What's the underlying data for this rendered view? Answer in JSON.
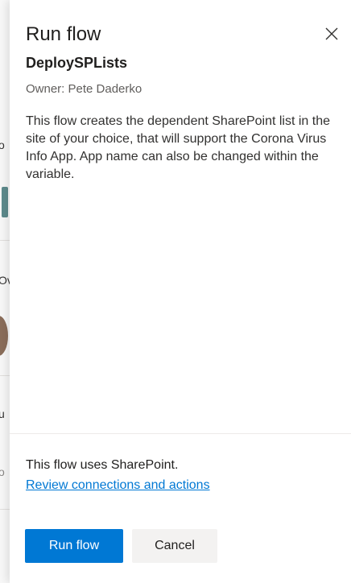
{
  "panel": {
    "title": "Run flow",
    "flow_name": "DeploySPLists",
    "owner": "Owner: Pete Daderko",
    "description": "This flow creates the dependent SharePoint list in the site of your choice, that will support the Corona Virus Info App. App name can also be changed within the variable.",
    "connections_text": "This flow uses SharePoint.",
    "review_link": "Review connections and actions",
    "run_button": "Run flow",
    "cancel_button": "Cancel",
    "close_icon": "close-icon"
  },
  "background_fragments": {
    "frag_1": "o",
    "frag_2": "Ov",
    "frag_3": "u",
    "frag_4": "o"
  },
  "colors": {
    "primary": "#0078d4",
    "link": "#0078d4",
    "cancel_bg": "#f3f2f1",
    "text": "#201f1e",
    "muted": "#605e5c"
  }
}
